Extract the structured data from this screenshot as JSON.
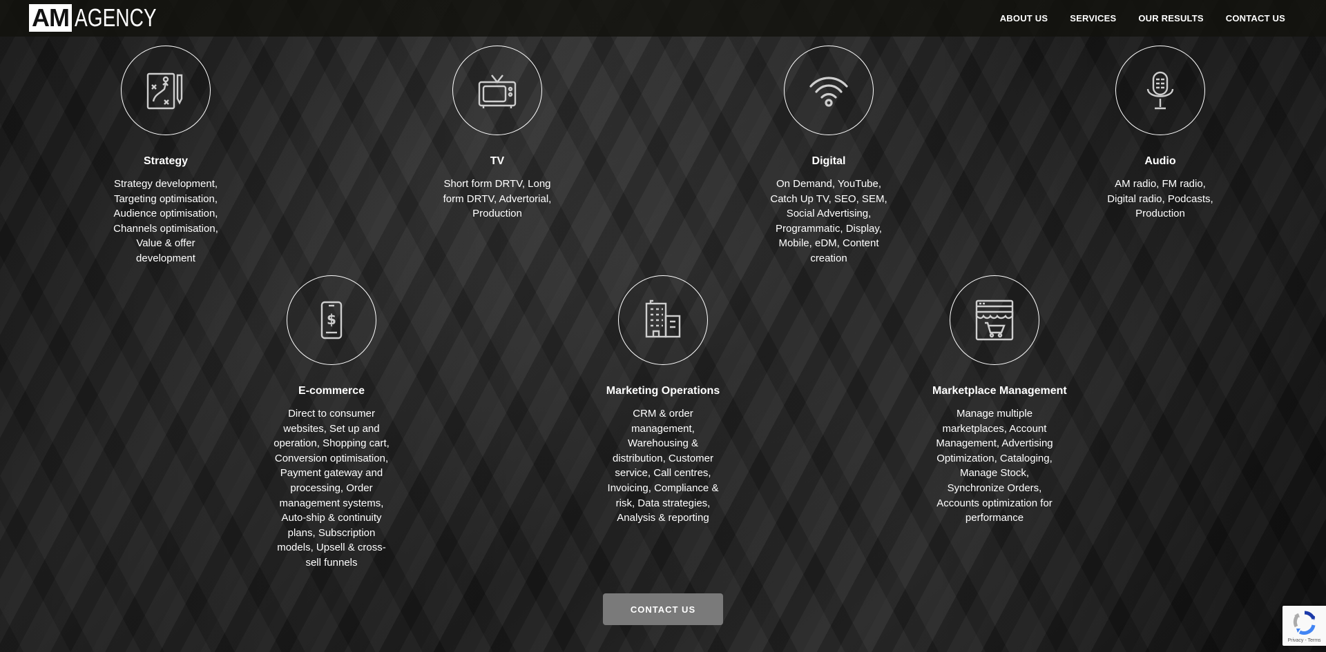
{
  "brand": {
    "logo_am": "AM",
    "logo_agency": "AGENCY"
  },
  "nav": {
    "items": [
      {
        "label": "ABOUT US"
      },
      {
        "label": "SERVICES"
      },
      {
        "label": "OUR RESULTS"
      },
      {
        "label": "CONTACT US"
      }
    ]
  },
  "services": [
    {
      "title": "Strategy",
      "icon": "strategy-playbook-icon",
      "description": "Strategy development, Targeting optimisation, Audience optimisation, Channels optimisation, Value & offer development"
    },
    {
      "title": "TV",
      "icon": "tv-icon",
      "description": "Short form DRTV, Long form DRTV, Advertorial, Production"
    },
    {
      "title": "Digital",
      "icon": "wifi-icon",
      "description": "On Demand, YouTube, Catch Up TV, SEO, SEM, Social Advertising, Programmatic, Display, Mobile, eDM, Content creation"
    },
    {
      "title": "Audio",
      "icon": "microphone-icon",
      "description": "AM radio, FM radio, Digital radio, Podcasts, Production"
    },
    {
      "title": "E-commerce",
      "icon": "mobile-dollar-icon",
      "description": "Direct to consumer websites, Set up and operation, Shopping cart, Conversion optimisation, Payment gateway and processing, Order management systems, Auto-ship & continuity plans, Subscription models, Upsell & cross-sell funnels"
    },
    {
      "title": "Marketing Operations",
      "icon": "office-building-icon",
      "description": "CRM & order management, Warehousing & distribution, Customer service, Call centres, Invoicing, Compliance & risk, Data strategies, Analysis & reporting"
    },
    {
      "title": "Marketplace Management",
      "icon": "storefront-cart-icon",
      "description": "Manage multiple marketplaces, Account Management, Advertising Optimization, Cataloging, Manage Stock, Synchronize Orders, Accounts optimization for performance"
    }
  ],
  "cta": {
    "label": "CONTACT US"
  },
  "recaptcha": {
    "links": "Privacy - Terms"
  }
}
